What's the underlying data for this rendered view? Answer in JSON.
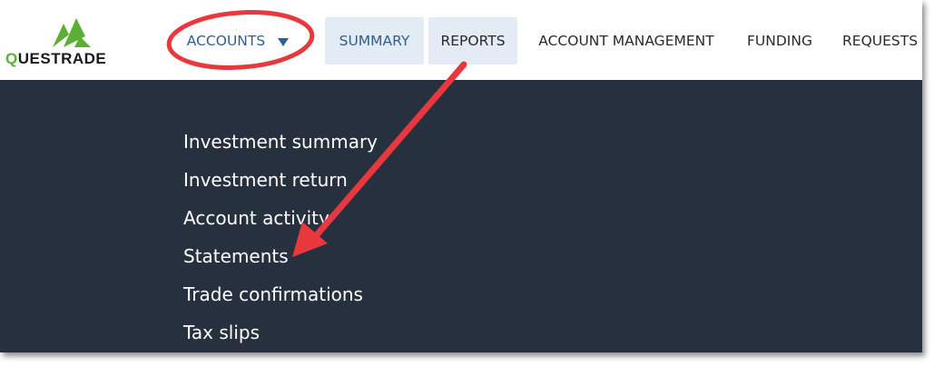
{
  "logo": {
    "text_first": "Q",
    "text_rest": "UESTRADE",
    "brand_color": "#5bb033"
  },
  "nav": {
    "accounts": "ACCOUNTS",
    "summary": "SUMMARY",
    "reports": "REPORTS",
    "account_management": "ACCOUNT MANAGEMENT",
    "funding": "FUNDING",
    "requests": "REQUESTS",
    "accent_color": "#2f5f8f",
    "highlight_color": "#e3ebf5"
  },
  "dropdown": {
    "background": "#27303e",
    "items": [
      "Investment summary",
      "Investment return",
      "Account activity",
      "Statements",
      "Trade confirmations",
      "Tax slips"
    ]
  },
  "annotation": {
    "color": "#e8383d",
    "shapes": [
      "circle-around-accounts",
      "arrow-to-statements"
    ]
  }
}
